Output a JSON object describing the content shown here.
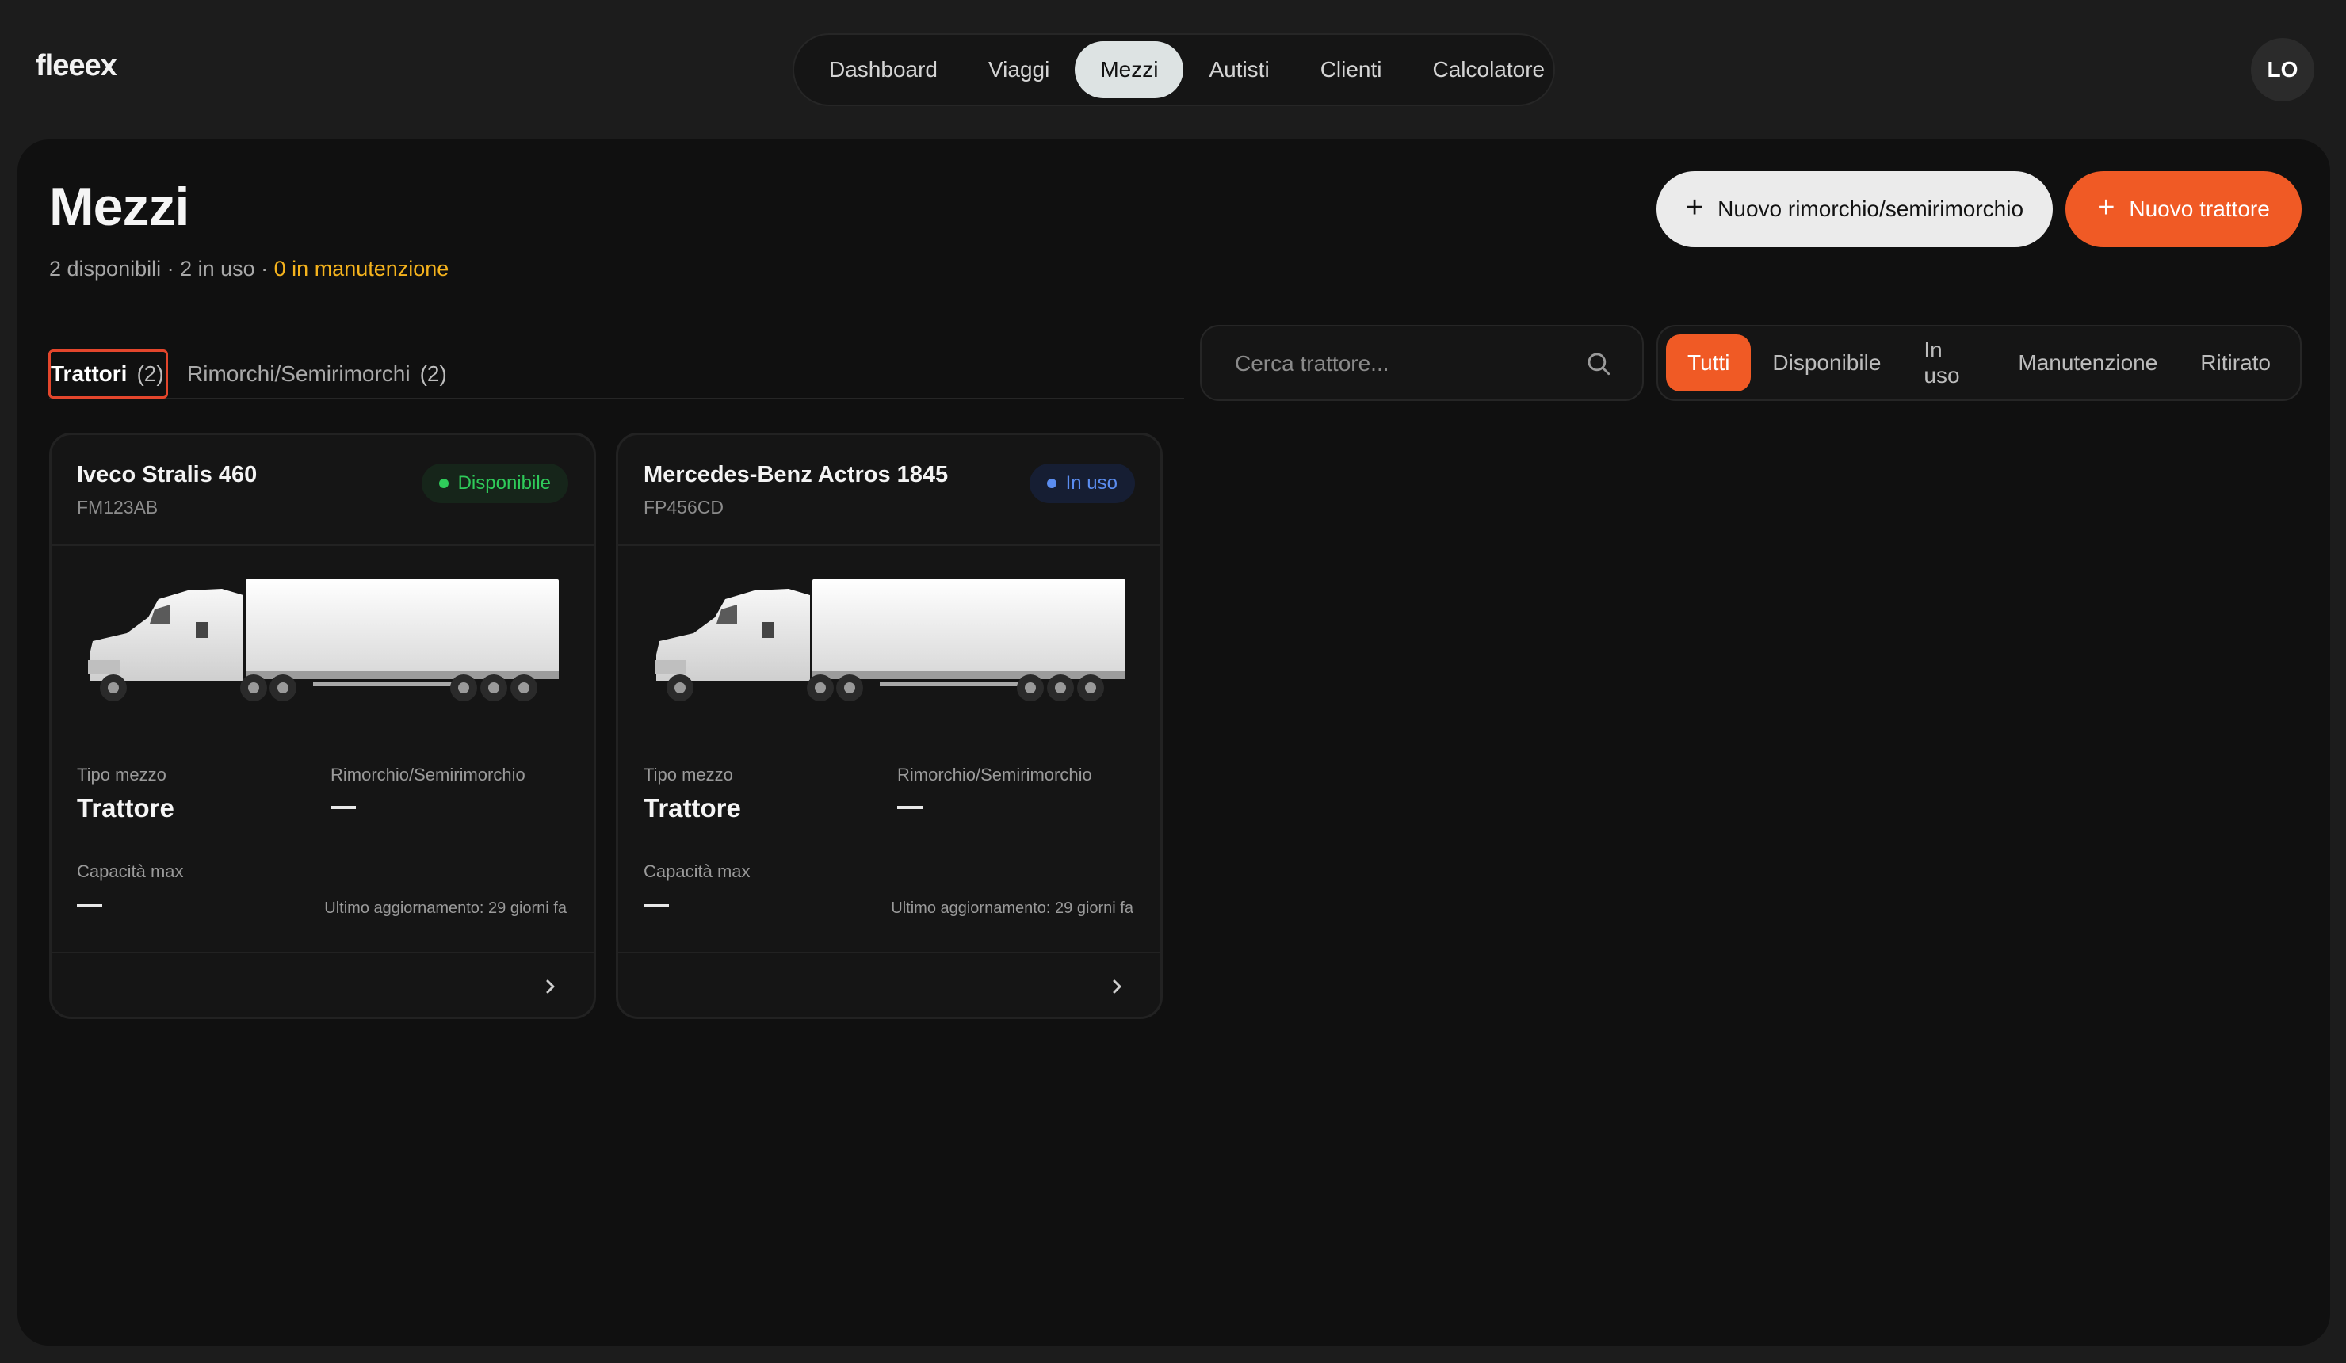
{
  "app": {
    "logo": "fleeex"
  },
  "nav": {
    "items": [
      {
        "label": "Dashboard",
        "active": false
      },
      {
        "label": "Viaggi",
        "active": false
      },
      {
        "label": "Mezzi",
        "active": true
      },
      {
        "label": "Autisti",
        "active": false
      },
      {
        "label": "Clienti",
        "active": false
      },
      {
        "label": "Calcolatore",
        "active": false
      }
    ]
  },
  "user": {
    "initials": "LO"
  },
  "page": {
    "title": "Mezzi",
    "summary_prefix": "2 disponibili · 2 in uso · ",
    "summary_maintenance": "0 in manutenzione"
  },
  "actions": {
    "new_trailer_label": "Nuovo rimorchio/semirimorchio",
    "new_tractor_label": "Nuovo trattore",
    "plus_icon": "plus-icon"
  },
  "tabs": [
    {
      "label": "Trattori",
      "count": "(2)",
      "active": true
    },
    {
      "label": "Rimorchi/Semirimorchi",
      "count": "(2)",
      "active": false
    }
  ],
  "search": {
    "placeholder": "Cerca trattore...",
    "value": "",
    "icon": "search-icon"
  },
  "filters": [
    {
      "label": "Tutti",
      "active": true
    },
    {
      "label": "Disponibile",
      "active": false
    },
    {
      "label": "In uso",
      "active": false
    },
    {
      "label": "Manutenzione",
      "active": false
    },
    {
      "label": "Ritirato",
      "active": false
    }
  ],
  "vehicles": [
    {
      "name": "Iveco Stralis 460",
      "plate": "FM123AB",
      "status": "Disponibile",
      "status_color": "#2fcb5a",
      "type_label": "Tipo mezzo",
      "type_value": "Trattore",
      "trailer_label": "Rimorchio/Semirimorchio",
      "trailer_value": "—",
      "capacity_label": "Capacità max",
      "capacity_value": "—",
      "updated": "Ultimo aggiornamento: 29 giorni fa"
    },
    {
      "name": "Mercedes-Benz Actros 1845",
      "plate": "FP456CD",
      "status": "In uso",
      "status_color": "#5b8df0",
      "type_label": "Tipo mezzo",
      "type_value": "Trattore",
      "trailer_label": "Rimorchio/Semirimorchio",
      "trailer_value": "—",
      "capacity_label": "Capacità max",
      "capacity_value": "—",
      "updated": "Ultimo aggiornamento: 29 giorni fa"
    }
  ],
  "colors": {
    "accent": "#f05a25",
    "maintenance": "#f5b31d",
    "background": "#1c1c1c",
    "panel": "#101010"
  }
}
